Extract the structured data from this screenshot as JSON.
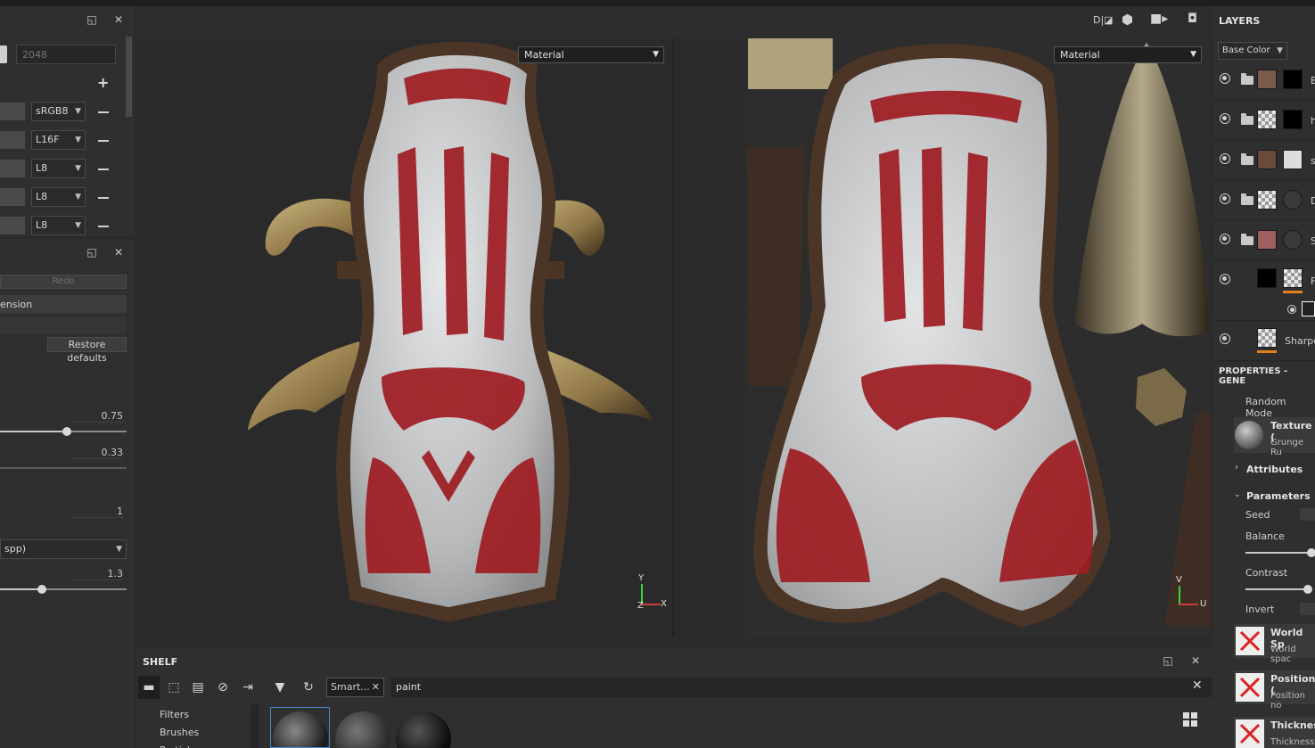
{
  "left_panel": {
    "resolution_value": "2048",
    "channel_formats": [
      "sRGB8",
      "L16F",
      "L8",
      "L8",
      "L8"
    ]
  },
  "history_panel": {
    "redo_label": "Redo",
    "dimension_label": "ension",
    "restore_label": "Restore defaults",
    "slider1_value": "0.75",
    "slider1_fraction": 0.75,
    "slider2_value": "0.33",
    "value3": "1",
    "sampling_label": "spp)",
    "slider4_value": "1.3",
    "slider4_fraction": 0.33
  },
  "viewport_3d": {
    "mode_label": "Material",
    "axis_y": "Y",
    "axis_x": "X",
    "axis_z": "Z"
  },
  "viewport_2d": {
    "mode_label": "Material",
    "axis_v": "V",
    "axis_u": "U"
  },
  "layers": {
    "title": "LAYERS",
    "channel_select": "Base Color",
    "rows": [
      {
        "name": "B"
      },
      {
        "name": "h"
      },
      {
        "name": "s"
      },
      {
        "name": "D"
      },
      {
        "name": "S"
      },
      {
        "name": "F"
      },
      {
        "name": "Sharpe"
      }
    ]
  },
  "properties": {
    "title": "PROPERTIES - GENE",
    "random_mode_label": "Random Mode",
    "texture_title": "Texture (",
    "texture_sub": "Grunge Ru",
    "attributes_label": "Attributes",
    "parameters_label": "Parameters",
    "seed_label": "Seed",
    "balance_label": "Balance",
    "contrast_label": "Contrast",
    "invert_label": "Invert",
    "inputs": [
      {
        "title": "World Sp",
        "sub": "World spac"
      },
      {
        "title": "Position (",
        "sub": "Position no"
      },
      {
        "title": "Thicknes",
        "sub": "Thickness"
      }
    ]
  },
  "shelf": {
    "title": "SHELF",
    "filter_chip": "Smart...",
    "search_value": "paint",
    "tree": [
      "Filters",
      "Brushes",
      "Particles"
    ]
  },
  "colors": {
    "accent_orange": "#e87f1f",
    "paint_red": "#9e1c22",
    "metal": "#c7c9cb"
  }
}
